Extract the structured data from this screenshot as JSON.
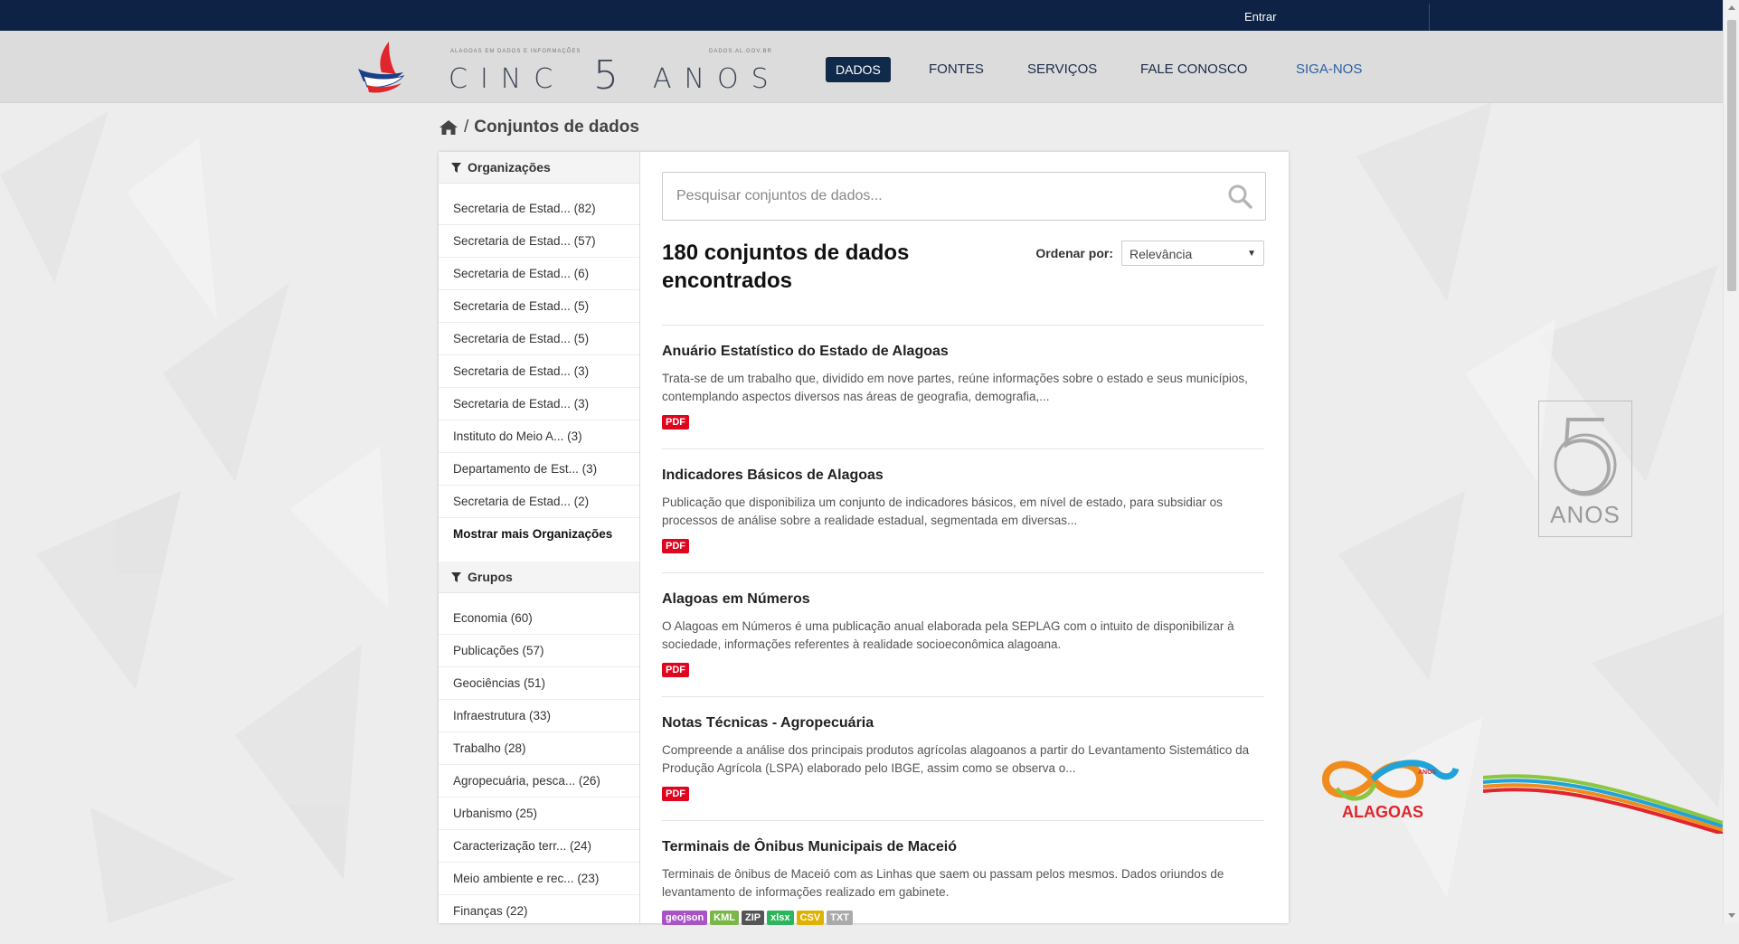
{
  "topbar": {
    "login": "Entrar"
  },
  "header": {
    "logo_small_left": "ALAGOAS EM DADOS E INFORMAÇÕES",
    "logo_small_right": "DADOS.AL.GOV.BR",
    "logo_word_left": "CINC",
    "logo_numeral": "5",
    "logo_word_right": "ANOS",
    "nav": [
      "DADOS",
      "FONTES",
      "SERVIÇOS",
      "FALE CONOSCO",
      "SIGA-NOS"
    ]
  },
  "breadcrumb": {
    "separator": "/",
    "current": "Conjuntos de dados"
  },
  "sidebar": {
    "organizations": {
      "title": "Organizações",
      "items": [
        "Secretaria de Estad... (82)",
        "Secretaria de Estad... (57)",
        "Secretaria de Estad... (6)",
        "Secretaria de Estad... (5)",
        "Secretaria de Estad... (5)",
        "Secretaria de Estad... (3)",
        "Secretaria de Estad... (3)",
        "Instituto do Meio A... (3)",
        "Departamento de Est... (3)",
        "Secretaria de Estad... (2)"
      ],
      "more": "Mostrar mais Organizações"
    },
    "groups": {
      "title": "Grupos",
      "items": [
        "Economia (60)",
        "Publicações (57)",
        "Geociências (51)",
        "Infraestrutura (33)",
        "Trabalho (28)",
        "Agropecuária, pesca... (26)",
        "Urbanismo (25)",
        "Caracterização terr... (24)",
        "Meio ambiente e rec... (23)",
        "Finanças (22)"
      ]
    }
  },
  "search": {
    "placeholder": "Pesquisar conjuntos de dados..."
  },
  "results": {
    "count_text": "180 conjuntos de dados encontrados",
    "sort_label": "Ordenar por:",
    "sort_value": "Relevância"
  },
  "datasets": [
    {
      "title": "Anuário Estatístico do Estado de Alagoas",
      "description": "Trata-se de um trabalho que, dividido em nove partes, reúne informações sobre o estado e seus municípios, contemplando aspectos diversos nas áreas de geografia, demografia,...",
      "formats": [
        "PDF"
      ]
    },
    {
      "title": "Indicadores Básicos de Alagoas",
      "description": "Publicação que disponibiliza um conjunto de indicadores básicos, em nível de estado, para subsidiar os processos de análise sobre a realidade estadual, segmentada em diversas...",
      "formats": [
        "PDF"
      ]
    },
    {
      "title": "Alagoas em Números",
      "description": "O Alagoas em Números é uma publicação anual elaborada pela SEPLAG com o intuito de disponibilizar à sociedade, informações referentes à realidade socioeconômica alagoana.",
      "formats": [
        "PDF"
      ]
    },
    {
      "title": "Notas Técnicas - Agropecuária",
      "description": "Compreende a análise dos principais produtos agrícolas alagoanos a partir do Levantamento Sistemático da Produção Agrícola (LSPA) elaborado pelo IBGE, assim como se observa o...",
      "formats": [
        "PDF"
      ]
    },
    {
      "title": "Terminais de Ônibus Municipais de Maceió",
      "description": "Terminais de ônibus de Maceió com as Linhas que saem ou passam pelos mesmos. Dados oriundos de levantamento de informações realizado em gabinete.",
      "formats": [
        "geojson",
        "KML",
        "ZIP",
        "xlsx",
        "CSV",
        "TXT"
      ]
    }
  ],
  "format_colors": {
    "PDF": "#e0051e",
    "geojson": "#a853c6",
    "KML": "#7ab648",
    "ZIP": "#555555",
    "xlsx": "#2db55d",
    "CSV": "#dfb100",
    "TXT": "#aaaaaa"
  },
  "decor": {
    "side_badge_numeral": "5",
    "side_badge_text": "ANOS",
    "alagoas_logo_small": "ANOS",
    "alagoas_logo_text": "ALAGOAS"
  },
  "colors": {
    "topbar": "#0d2244",
    "nav_active": "#0f2a4a",
    "accent_link": "#2a5fa3"
  },
  "icons": [
    "home-icon",
    "filter-icon",
    "search-icon",
    "chevron-down-icon"
  ]
}
